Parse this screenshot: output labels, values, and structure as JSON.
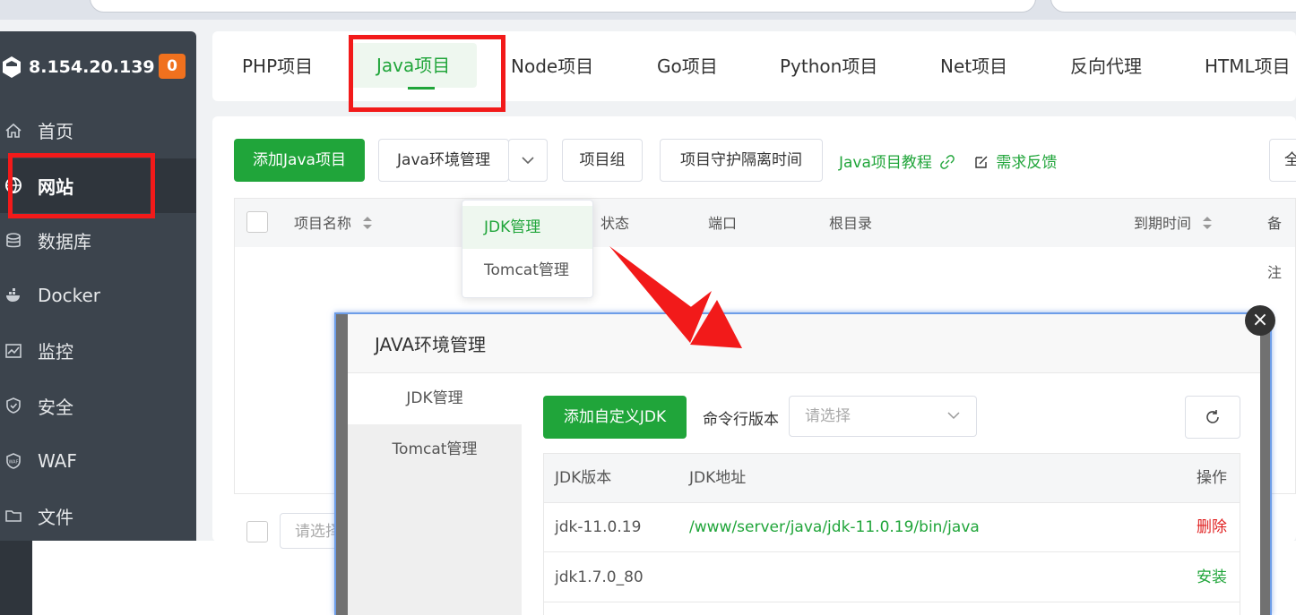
{
  "sidebar": {
    "server_ip": "8.154.20.139",
    "badge_count": "0",
    "items": [
      {
        "label": "首页",
        "icon": "home-icon"
      },
      {
        "label": "网站",
        "icon": "globe-icon"
      },
      {
        "label": "数据库",
        "icon": "database-icon"
      },
      {
        "label": "Docker",
        "icon": "docker-icon"
      },
      {
        "label": "监控",
        "icon": "monitor-icon"
      },
      {
        "label": "安全",
        "icon": "shield-icon"
      },
      {
        "label": "WAF",
        "icon": "waf-shield-icon"
      },
      {
        "label": "文件",
        "icon": "folder-icon"
      }
    ],
    "active_item": "网站"
  },
  "tabs": [
    {
      "label": "PHP项目"
    },
    {
      "label": "Java项目"
    },
    {
      "label": "Node项目"
    },
    {
      "label": "Go项目"
    },
    {
      "label": "Python项目"
    },
    {
      "label": "Net项目"
    },
    {
      "label": "反向代理"
    },
    {
      "label": "HTML项目"
    }
  ],
  "active_tab": "Java项目",
  "toolbar": {
    "add_java_project": "添加Java项目",
    "java_env_manage": "Java环境管理",
    "project_group": "项目组",
    "guard_interval": "项目守护隔离时间",
    "java_tutorial": "Java项目教程",
    "feedback": "需求反馈",
    "right_partial": "全"
  },
  "table": {
    "headers": [
      "项目名称",
      "状态",
      "端口",
      "根目录",
      "到期时间",
      "备注"
    ],
    "footer_select_placeholder": "请选择"
  },
  "dropdown": {
    "options": [
      "JDK管理",
      "Tomcat管理"
    ],
    "active": "JDK管理"
  },
  "modal": {
    "title": "JAVA环境管理",
    "side_items": [
      "JDK管理",
      "Tomcat管理"
    ],
    "add_custom_jdk": "添加自定义JDK",
    "cli_version_label": "命令行版本",
    "cli_version_placeholder": "请选择",
    "table_headers": [
      "JDK版本",
      "JDK地址",
      "操作"
    ],
    "rows": [
      {
        "version": "jdk-11.0.19",
        "path": "/www/server/java/jdk-11.0.19/bin/java",
        "action": "删除",
        "action_color": "#e02020"
      },
      {
        "version": "jdk1.7.0_80",
        "path": "",
        "action": "安装",
        "action_color": "#20a53a"
      }
    ]
  },
  "colors": {
    "accent_green": "#20a53a",
    "highlight_red": "#f21a1a",
    "sidebar_bg": "#3c444d",
    "badge_orange": "#f0711e"
  }
}
